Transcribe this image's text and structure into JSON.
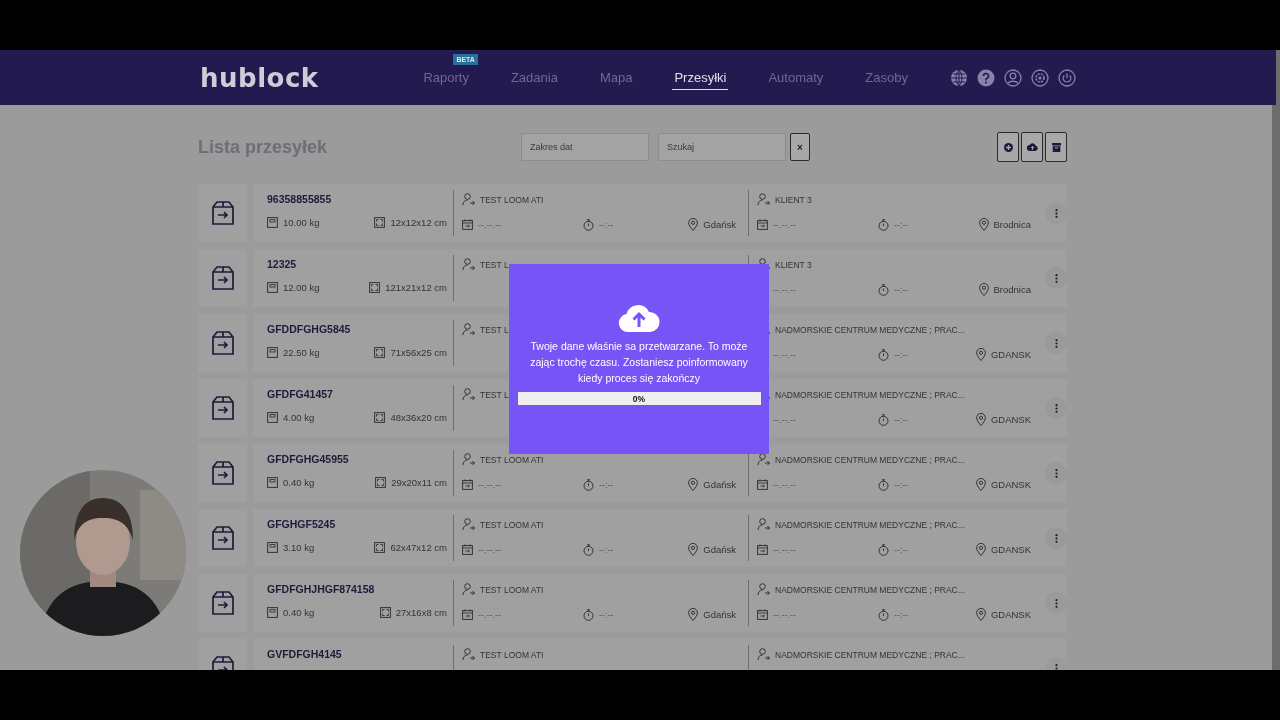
{
  "nav": {
    "logo": "hublock",
    "items": [
      {
        "label": "Raporty",
        "selected": false,
        "badge": "BETA"
      },
      {
        "label": "Zadania",
        "selected": false
      },
      {
        "label": "Mapa",
        "selected": false
      },
      {
        "label": "Przesyłki",
        "selected": true
      },
      {
        "label": "Automaty",
        "selected": false
      },
      {
        "label": "Zasoby",
        "selected": false
      }
    ]
  },
  "page": {
    "title": "Lista przesyłek",
    "date_range": {
      "placeholder": "Zakres dat"
    },
    "search": {
      "placeholder": "Szukaj"
    },
    "clear_button": "×"
  },
  "shipments": [
    {
      "number": "96358855855",
      "weight": "10.00 kg",
      "dimensions": "12x12x12 cm",
      "sender": {
        "name": "TEST LOOM ATI",
        "date": "--.--.--",
        "time": "--:--",
        "city": "Gdańsk"
      },
      "receiver": {
        "name": "KLIENT 3",
        "date": "--.--.--",
        "time": "--:--",
        "city": "Brodnica"
      }
    },
    {
      "number": "12325",
      "weight": "12.00 kg",
      "dimensions": "121x21x12 cm",
      "sender": {
        "name": "TEST L"
      },
      "receiver": {
        "name": "KLIENT 3",
        "date": "--.--.--",
        "time": "--:--",
        "city": "Brodnica"
      }
    },
    {
      "number": "GFDDFGHG5845",
      "weight": "22.50 kg",
      "dimensions": "71x56x25 cm",
      "sender": {
        "name": "TEST L"
      },
      "receiver": {
        "name": "NADMORSKIE CENTRUM MEDYCZNE ; PRAC...",
        "date": "--.--.--",
        "time": "--:--",
        "city": "GDANSK"
      }
    },
    {
      "number": "GFDFG41457",
      "weight": "4.00 kg",
      "dimensions": "48x36x20 cm",
      "sender": {
        "name": "TEST L"
      },
      "receiver": {
        "name": "NADMORSKIE CENTRUM MEDYCZNE ; PRAC...",
        "date": "--.--.--",
        "time": "--:--",
        "city": "GDANSK"
      }
    },
    {
      "number": "GFDFGHG45955",
      "weight": "0.40 kg",
      "dimensions": "29x20x11 cm",
      "sender": {
        "name": "TEST LOOM ATI",
        "date": "--.--.--",
        "time": "--:--",
        "city": "Gdańsk"
      },
      "receiver": {
        "name": "NADMORSKIE CENTRUM MEDYCZNE ; PRAC...",
        "date": "--.--.--",
        "time": "--:--",
        "city": "GDANSK"
      }
    },
    {
      "number": "GFGHGF5245",
      "weight": "3.10 kg",
      "dimensions": "62x47x12 cm",
      "sender": {
        "name": "TEST LOOM ATI",
        "date": "--.--.--",
        "time": "--:--",
        "city": "Gdańsk"
      },
      "receiver": {
        "name": "NADMORSKIE CENTRUM MEDYCZNE ; PRAC...",
        "date": "--.--.--",
        "time": "--:--",
        "city": "GDANSK"
      }
    },
    {
      "number": "GFDFGHJHGF874158",
      "weight": "0.40 kg",
      "dimensions": "27x16x8 cm",
      "sender": {
        "name": "TEST LOOM ATI",
        "date": "--.--.--",
        "time": "--:--",
        "city": "Gdańsk"
      },
      "receiver": {
        "name": "NADMORSKIE CENTRUM MEDYCZNE ; PRAC...",
        "date": "--.--.--",
        "time": "--:--",
        "city": "GDANSK"
      }
    },
    {
      "number": "GVFDFGH4145",
      "sender": {
        "name": "TEST LOOM ATI"
      },
      "receiver": {
        "name": "NADMORSKIE CENTRUM MEDYCZNE ; PRAC..."
      }
    }
  ],
  "dialog": {
    "message": "Twoje dane właśnie sa przetwarzane. To może zając trochę czasu. Zostaniesz poinformowany kiedy proces się zakończy",
    "progress": {
      "level": 0,
      "label": "0%"
    }
  }
}
